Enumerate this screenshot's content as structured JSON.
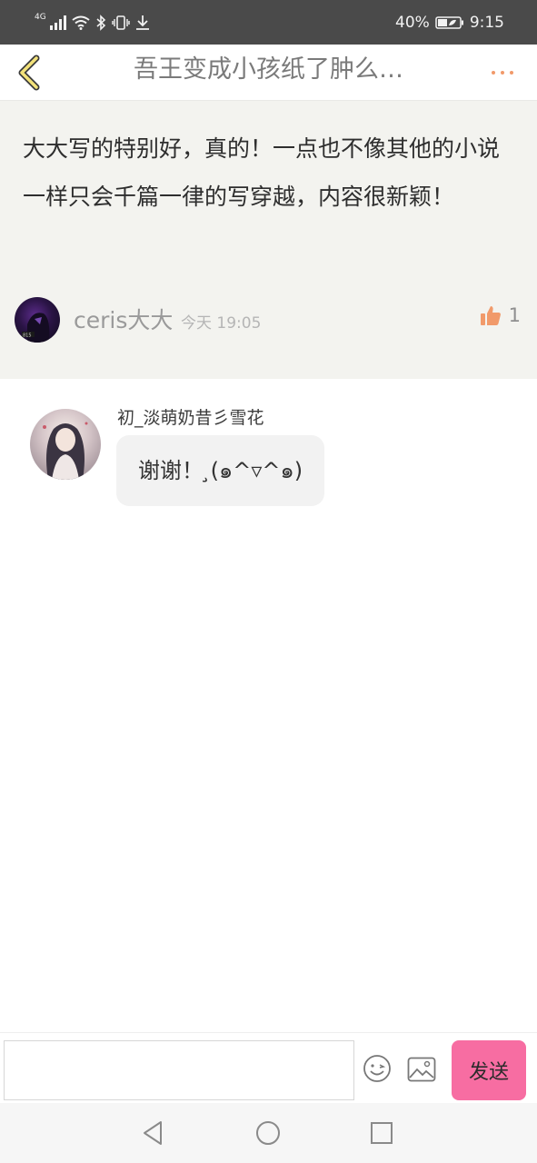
{
  "status_bar": {
    "network": "4G",
    "battery": "40%",
    "time": "9:15"
  },
  "header": {
    "title": "吾王变成小孩纸了肿么…",
    "back_icon": "chevron-left-icon",
    "more_icon": "more-dots-icon"
  },
  "comment": {
    "text": "大大写的特别好，真的！一点也不像其他的小说一样只会千篇一律的写穿越，内容很新颖！",
    "author": "ceris大大",
    "time": "今天 19:05",
    "likes": "1"
  },
  "reply": {
    "author": "初_淡萌奶昔彡雪花",
    "text": "谢谢！ ̧(๑^▿^๑)"
  },
  "input_bar": {
    "placeholder": "",
    "send_label": "发送"
  },
  "colors": {
    "accent": "#f19a6a",
    "send_button": "#f76da2",
    "comment_bg": "#f3f3ef"
  }
}
